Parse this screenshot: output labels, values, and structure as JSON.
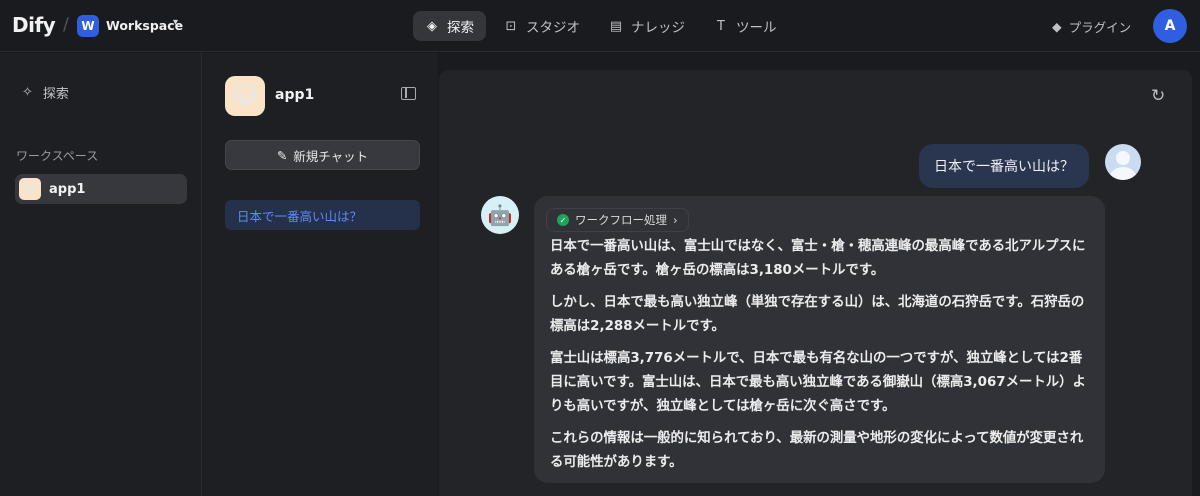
{
  "header": {
    "logo": "Dify",
    "workspace_badge": "W",
    "workspace_name": "Workspace",
    "nav": [
      {
        "label": "探索",
        "icon": "compass-icon"
      },
      {
        "label": "スタジオ",
        "icon": "robot-icon"
      },
      {
        "label": "ナレッジ",
        "icon": "book-icon"
      },
      {
        "label": "ツール",
        "icon": "hammer-icon"
      }
    ],
    "plugin_label": "プラグイン",
    "user_initial": "A"
  },
  "sidebar": {
    "explore_label": "探索",
    "section_title": "ワークスペース",
    "apps": [
      {
        "label": "app1",
        "icon": "cat-emoji-icon"
      }
    ]
  },
  "conversation_panel": {
    "app_name": "app1",
    "new_chat_label": "新規チャット",
    "conversations": [
      "日本で一番高い山は？"
    ]
  },
  "chat": {
    "user_message": "日本で一番高い山は？",
    "workflow_label": "ワークフロー処理",
    "bot_paragraphs": [
      "日本で一番高い山は、富士山ではなく、富士・槍・穂高連峰の最高峰である北アルプスにある槍ヶ岳です。槍ヶ岳の標高は3,180メートルです。",
      "しかし、日本で最も高い独立峰（単独で存在する山）は、北海道の石狩岳です。石狩岳の標高は2,288メートルです。",
      "富士山は標高3,776メートルで、日本で最も有名な山の一つですが、独立峰としては2番目に高いです。富士山は、日本で最も高い独立峰である御嶽山（標高3,067メートル）よりも高いですが、独立峰としては槍ヶ岳に次ぐ高さです。",
      "これらの情報は一般的に知られており、最新の測量や地形の変化によって数値が変更される可能性があります。"
    ]
  }
}
